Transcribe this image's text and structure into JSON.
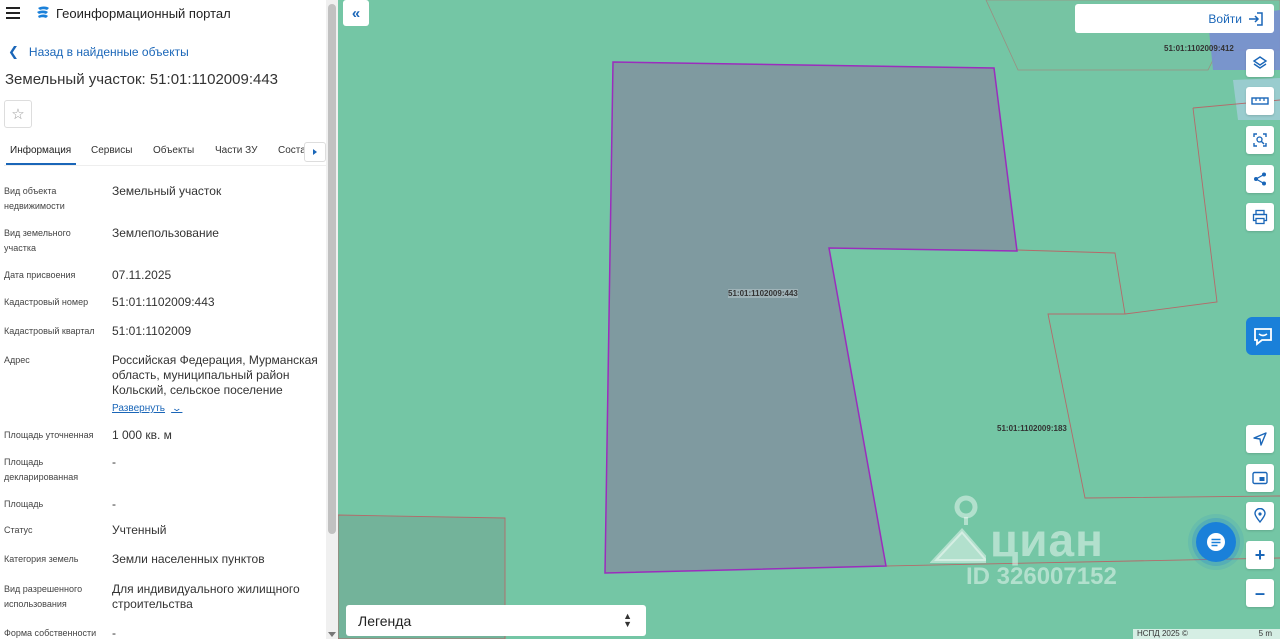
{
  "app": {
    "title": "Геоинформационный портал"
  },
  "nav": {
    "back_label": "Назад в найденные объекты"
  },
  "object": {
    "title": "Земельный участок: 51:01:1102009:443"
  },
  "tabs": [
    {
      "label": "Информация"
    },
    {
      "label": "Сервисы"
    },
    {
      "label": "Объекты"
    },
    {
      "label": "Части ЗУ"
    },
    {
      "label": "Соста"
    }
  ],
  "properties": [
    {
      "label": "Вид объекта недвижимости",
      "value": "Земельный участок"
    },
    {
      "label": "Вид земельного участка",
      "value": "Землепользование"
    },
    {
      "label": "Дата присвоения",
      "value": "07.11.2025"
    },
    {
      "label": "Кадастровый номер",
      "value": "51:01:1102009:443"
    },
    {
      "label": "Кадастровый квартал",
      "value": "51:01:1102009"
    },
    {
      "label": "Адрес",
      "value": "Российская Федерация, Мурманская область, муниципальный район Кольский, сельское поселение",
      "link": "Развернуть"
    },
    {
      "label": "Площадь уточненная",
      "value": "1 000 кв. м"
    },
    {
      "label": "Площадь декларированная",
      "value": "-"
    },
    {
      "label": "Площадь",
      "value": "-"
    },
    {
      "label": "Статус",
      "value": "Учтенный"
    },
    {
      "label": "Категория земель",
      "value": "Земли населенных пунктов"
    },
    {
      "label": "Вид разрешенного использования",
      "value": "Для индивидуального жилищного строительства"
    },
    {
      "label": "Форма собственности",
      "value": "-"
    }
  ],
  "map": {
    "login_label": "Войти",
    "legend_label": "Легенда",
    "parcels": [
      {
        "id": "51:01:1102009:443"
      },
      {
        "id": "51:01:1102009:412"
      },
      {
        "id": "51:01:1102009:183"
      }
    ],
    "watermark": {
      "brand": "циан",
      "id_text": "ID 326007152"
    },
    "attribution": {
      "text": "НСПД 2025 ©",
      "scale": "5 m"
    },
    "colors": {
      "background": "#74c6a5",
      "selected_fill": "#7f9aa0",
      "selected_stroke": "#9b2dbd",
      "accent": "#1a66b8"
    },
    "tools": [
      "layers-icon",
      "ruler-icon",
      "select-area-icon",
      "share-icon",
      "print-icon",
      "navigate-icon",
      "minimap-icon",
      "locate-icon",
      "zoom-in-icon",
      "zoom-out-icon"
    ]
  }
}
